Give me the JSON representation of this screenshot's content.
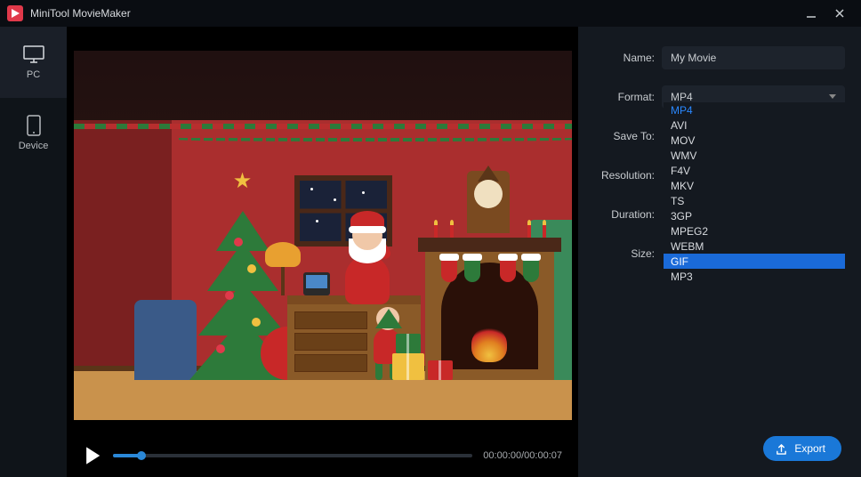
{
  "app": {
    "title": "MiniTool MovieMaker"
  },
  "sidebar": {
    "items": [
      {
        "label": "PC"
      },
      {
        "label": "Device"
      }
    ]
  },
  "player": {
    "timecode": "00:00:00/00:00:07"
  },
  "form": {
    "name_label": "Name:",
    "name_value": "My Movie",
    "format_label": "Format:",
    "format_value": "MP4",
    "saveto_label": "Save To:",
    "resolution_label": "Resolution:",
    "duration_label": "Duration:",
    "size_label": "Size:"
  },
  "format_options": [
    "MP4",
    "AVI",
    "MOV",
    "WMV",
    "F4V",
    "MKV",
    "TS",
    "3GP",
    "MPEG2",
    "WEBM",
    "GIF",
    "MP3"
  ],
  "format_selected": "MP4",
  "format_hover": "GIF",
  "export": {
    "label": "Export"
  }
}
